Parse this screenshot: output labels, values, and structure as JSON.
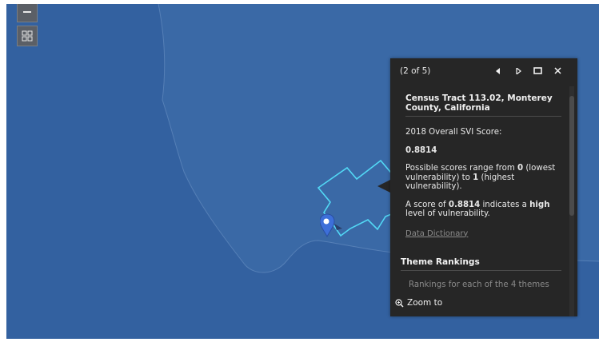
{
  "map": {
    "water_color": "#3a69a6",
    "land_color": "#2f5e9c",
    "tract_outline_color": "#52d8f5",
    "controls": {
      "zoom_out_icon": "minus-icon",
      "basemap_icon": "basemap-gallery-icon"
    }
  },
  "popup": {
    "pager": "(2 of 5)",
    "icons": {
      "previous": "triangle-left-icon",
      "next": "triangle-right-icon",
      "maximize": "maximize-icon",
      "close": "close-icon"
    },
    "title": "Census Tract 113.02, Monterey County, California",
    "score_label": "2018 Overall SVI Score:",
    "score_value": "0.8814",
    "range_text": {
      "prefix": "Possible scores range from ",
      "min": "0",
      "middle": " (lowest vulnerability) to ",
      "max": "1",
      "suffix": " (highest vulnerability)."
    },
    "description": {
      "prefix": "A score of ",
      "score": "0.8814",
      "middle": " indicates a ",
      "level": "high",
      "suffix": " level of vulnerability."
    },
    "link_label": "Data Dictionary",
    "section_title": "Theme Rankings",
    "rankings_text": "Rankings for each of the 4 themes",
    "zoom_to_label": "Zoom to"
  }
}
